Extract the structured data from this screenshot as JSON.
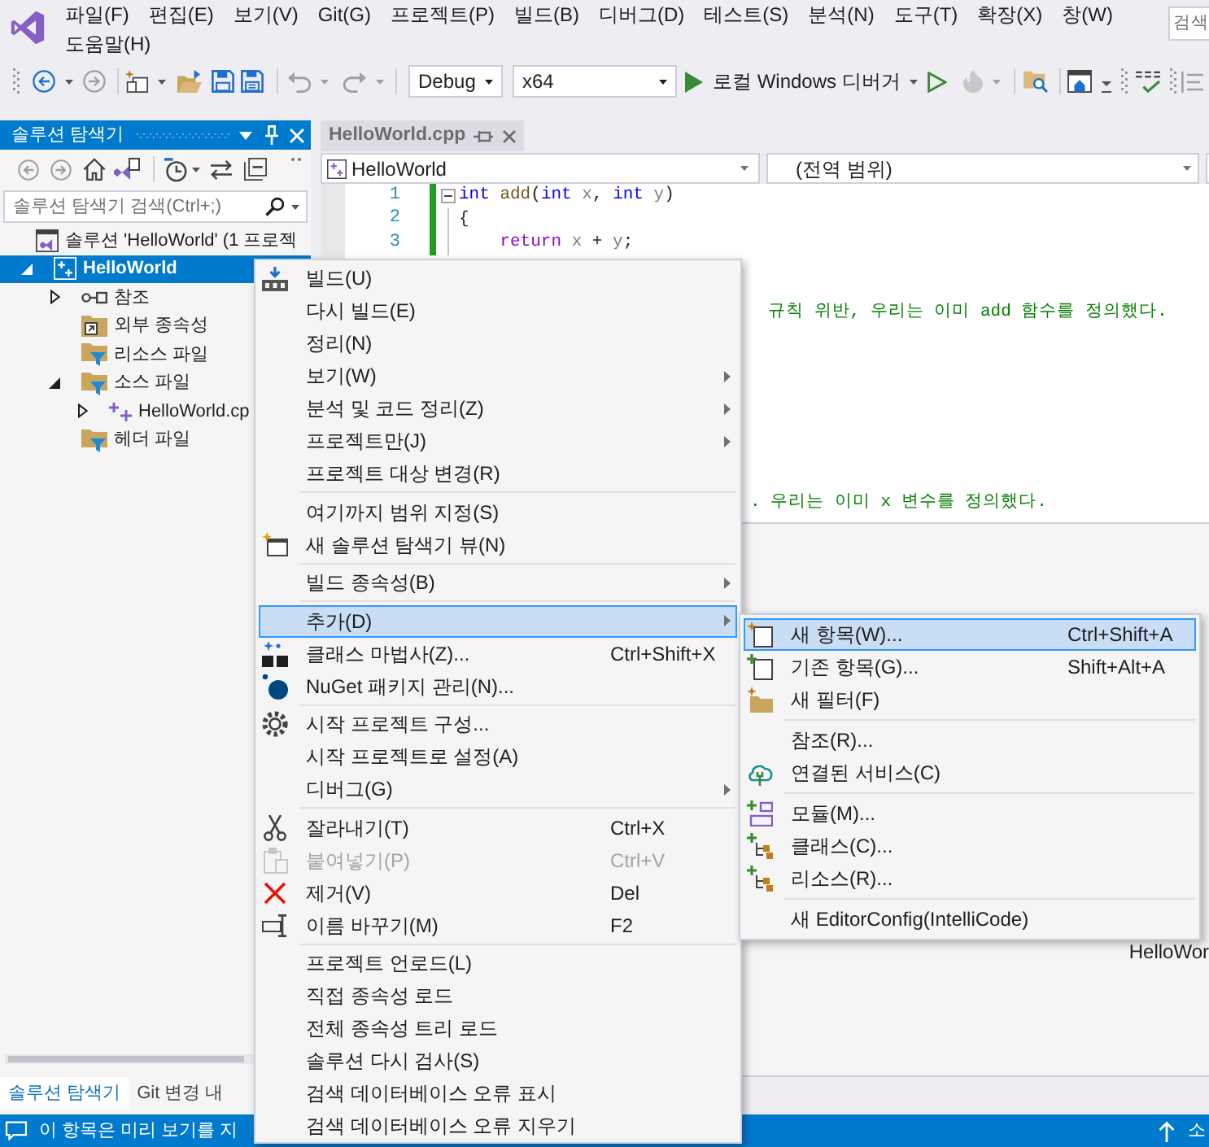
{
  "menu_bar": {
    "items": [
      "파일(F)",
      "편집(E)",
      "보기(V)",
      "Git(G)",
      "프로젝트(P)",
      "빌드(B)",
      "디버그(D)",
      "테스트(S)",
      "분석(N)",
      "도구(T)",
      "확장(X)",
      "창(W)",
      "도움말(H)"
    ],
    "search": {
      "placeholder": "검색"
    }
  },
  "toolbar": {
    "configuration": "Debug",
    "platform": "x64",
    "debugger": "로컬 Windows 디버거"
  },
  "solution_explorer": {
    "title": "솔루션 탐색기",
    "search": {
      "placeholder": "솔루션 탐색기 검색(Ctrl+;)"
    },
    "tree": [
      {
        "kind": "solution",
        "label": "솔루션 'HelloWorld' (1 프로젝",
        "selected": false,
        "children": [
          {
            "kind": "project",
            "label": "HelloWorld",
            "expanded": true,
            "selected": true,
            "children": [
              {
                "kind": "references",
                "label": "참조",
                "expanded": false,
                "selected": false
              },
              {
                "kind": "dependencies",
                "label": "외부 종속성",
                "selected": false
              },
              {
                "kind": "filter",
                "label": "리소스 파일",
                "selected": false
              },
              {
                "kind": "filter",
                "label": "소스 파일",
                "expanded": true,
                "selected": false,
                "children": [
                  {
                    "kind": "file",
                    "label": "HelloWorld.cp",
                    "expanded": false,
                    "selected": false
                  }
                ]
              },
              {
                "kind": "filter",
                "label": "헤더 파일",
                "selected": false
              }
            ]
          }
        ]
      }
    ],
    "tabs": [
      {
        "label": "솔루션 탐색기",
        "selected": true
      },
      {
        "label": "Git 변경 내",
        "selected": false
      }
    ]
  },
  "editor": {
    "tabs": [
      {
        "label": "HelloWorld.cpp",
        "selected": true
      }
    ],
    "navigation": {
      "project": "HelloWorld",
      "scope": "(전역 범위)"
    },
    "lines": [
      {
        "number": "1",
        "modified": true,
        "foldable": true,
        "tokens": [
          {
            "kind": "keyword",
            "text": "int"
          },
          {
            "kind": "function",
            "text": " add"
          },
          {
            "kind": "plain",
            "text": "("
          },
          {
            "kind": "keyword",
            "text": "int"
          },
          {
            "kind": "param",
            "text": " x"
          },
          {
            "kind": "plain",
            "text": ", "
          },
          {
            "kind": "keyword",
            "text": "int"
          },
          {
            "kind": "param",
            "text": " y"
          },
          {
            "kind": "plain",
            "text": ")"
          }
        ]
      },
      {
        "number": "2",
        "modified": true,
        "foldable": false,
        "tokens": [
          {
            "kind": "plain",
            "text": "{"
          }
        ]
      },
      {
        "number": "3",
        "modified": true,
        "foldable": false,
        "tokens": [
          {
            "kind": "control",
            "text": "    return"
          },
          {
            "kind": "param",
            "text": " x"
          },
          {
            "kind": "plain",
            "text": " + "
          },
          {
            "kind": "param",
            "text": "y"
          },
          {
            "kind": "plain",
            "text": ";"
          }
        ]
      }
    ],
    "partial_lines": [
      {
        "text": "규칙 위반, 우리는 이미 add 함수를 정의했다."
      },
      {
        "text": ". 우리는 이미 x 변수를 정의했다."
      }
    ]
  },
  "output_panel": {
    "fragment": "HelloWor"
  },
  "context_menu": {
    "items": [
      {
        "kind": "build",
        "label": "빌드(U)",
        "submenu": false,
        "disabled": false,
        "selected": false
      },
      {
        "kind": "command",
        "label": "다시 빌드(E)",
        "submenu": false,
        "disabled": false,
        "selected": false
      },
      {
        "kind": "command",
        "label": "정리(N)",
        "submenu": false,
        "disabled": false,
        "selected": false
      },
      {
        "kind": "command",
        "label": "보기(W)",
        "submenu": true,
        "disabled": false,
        "selected": false
      },
      {
        "kind": "command",
        "label": "분석 및 코드 정리(Z)",
        "submenu": true,
        "disabled": false,
        "selected": false
      },
      {
        "kind": "command",
        "label": "프로젝트만(J)",
        "submenu": true,
        "disabled": false,
        "selected": false
      },
      {
        "kind": "command",
        "label": "프로젝트 대상 변경(R)",
        "submenu": false,
        "disabled": false,
        "selected": false
      },
      {
        "kind": "separator"
      },
      {
        "kind": "command",
        "label": "여기까지 범위 지정(S)",
        "submenu": false,
        "disabled": false,
        "selected": false
      },
      {
        "kind": "view",
        "label": "새 솔루션 탐색기 뷰(N)",
        "submenu": false,
        "disabled": false,
        "selected": false
      },
      {
        "kind": "separator"
      },
      {
        "kind": "command",
        "label": "빌드 종속성(B)",
        "submenu": true,
        "disabled": false,
        "selected": false
      },
      {
        "kind": "separator"
      },
      {
        "kind": "command",
        "label": "추가(D)",
        "submenu": true,
        "disabled": false,
        "selected": true
      },
      {
        "kind": "wizard",
        "label": "클래스 마법사(Z)...",
        "shortcut": "Ctrl+Shift+X",
        "submenu": false,
        "disabled": false,
        "selected": false
      },
      {
        "kind": "package",
        "label": "NuGet 패키지 관리(N)...",
        "submenu": false,
        "disabled": false,
        "selected": false
      },
      {
        "kind": "separator"
      },
      {
        "kind": "configure",
        "label": "시작 프로젝트 구성...",
        "submenu": false,
        "disabled": false,
        "selected": false
      },
      {
        "kind": "command",
        "label": "시작 프로젝트로 설정(A)",
        "submenu": false,
        "disabled": false,
        "selected": false
      },
      {
        "kind": "command",
        "label": "디버그(G)",
        "submenu": true,
        "disabled": false,
        "selected": false
      },
      {
        "kind": "separator"
      },
      {
        "kind": "cut",
        "label": "잘라내기(T)",
        "shortcut": "Ctrl+X",
        "submenu": false,
        "disabled": false,
        "selected": false
      },
      {
        "kind": "paste",
        "label": "붙여넣기(P)",
        "shortcut": "Ctrl+V",
        "submenu": false,
        "disabled": true,
        "selected": false
      },
      {
        "kind": "remove",
        "label": "제거(V)",
        "shortcut": "Del",
        "submenu": false,
        "disabled": false,
        "selected": false
      },
      {
        "kind": "rename",
        "label": "이름 바꾸기(M)",
        "shortcut": "F2",
        "submenu": false,
        "disabled": false,
        "selected": false
      },
      {
        "kind": "separator"
      },
      {
        "kind": "command",
        "label": "프로젝트 언로드(L)",
        "submenu": false,
        "disabled": false,
        "selected": false
      },
      {
        "kind": "command",
        "label": "직접 종속성 로드",
        "submenu": false,
        "disabled": false,
        "selected": false
      },
      {
        "kind": "command",
        "label": "전체 종속성 트리 로드",
        "submenu": false,
        "disabled": false,
        "selected": false
      },
      {
        "kind": "command",
        "label": "솔루션 다시 검사(S)",
        "submenu": false,
        "disabled": false,
        "selected": false
      },
      {
        "kind": "command",
        "label": "검색 데이터베이스 오류 표시",
        "submenu": false,
        "disabled": false,
        "selected": false
      },
      {
        "kind": "command",
        "label": "검색 데이터베이스 오류 지우기",
        "submenu": false,
        "disabled": false,
        "selected": false
      }
    ]
  },
  "submenu": {
    "items": [
      {
        "kind": "newitem",
        "label": "새 항목(W)...",
        "shortcut": "Ctrl+Shift+A",
        "selected": true
      },
      {
        "kind": "existing",
        "label": "기존 항목(G)...",
        "shortcut": "Shift+Alt+A",
        "selected": false
      },
      {
        "kind": "filter",
        "label": "새 필터(F)",
        "selected": false
      },
      {
        "kind": "separator"
      },
      {
        "kind": "command",
        "label": "참조(R)...",
        "selected": false
      },
      {
        "kind": "service",
        "label": "연결된 서비스(C)",
        "selected": false
      },
      {
        "kind": "separator"
      },
      {
        "kind": "module",
        "label": "모듈(M)...",
        "selected": false
      },
      {
        "kind": "class",
        "label": "클래스(C)...",
        "selected": false
      },
      {
        "kind": "resource",
        "label": "리소스(R)...",
        "selected": false
      },
      {
        "kind": "separator"
      },
      {
        "kind": "command",
        "label": "새 EditorConfig(IntelliCode)",
        "selected": false
      }
    ]
  },
  "status_bar": {
    "message": "이 항목은 미리 보기를 지",
    "right": "소"
  }
}
